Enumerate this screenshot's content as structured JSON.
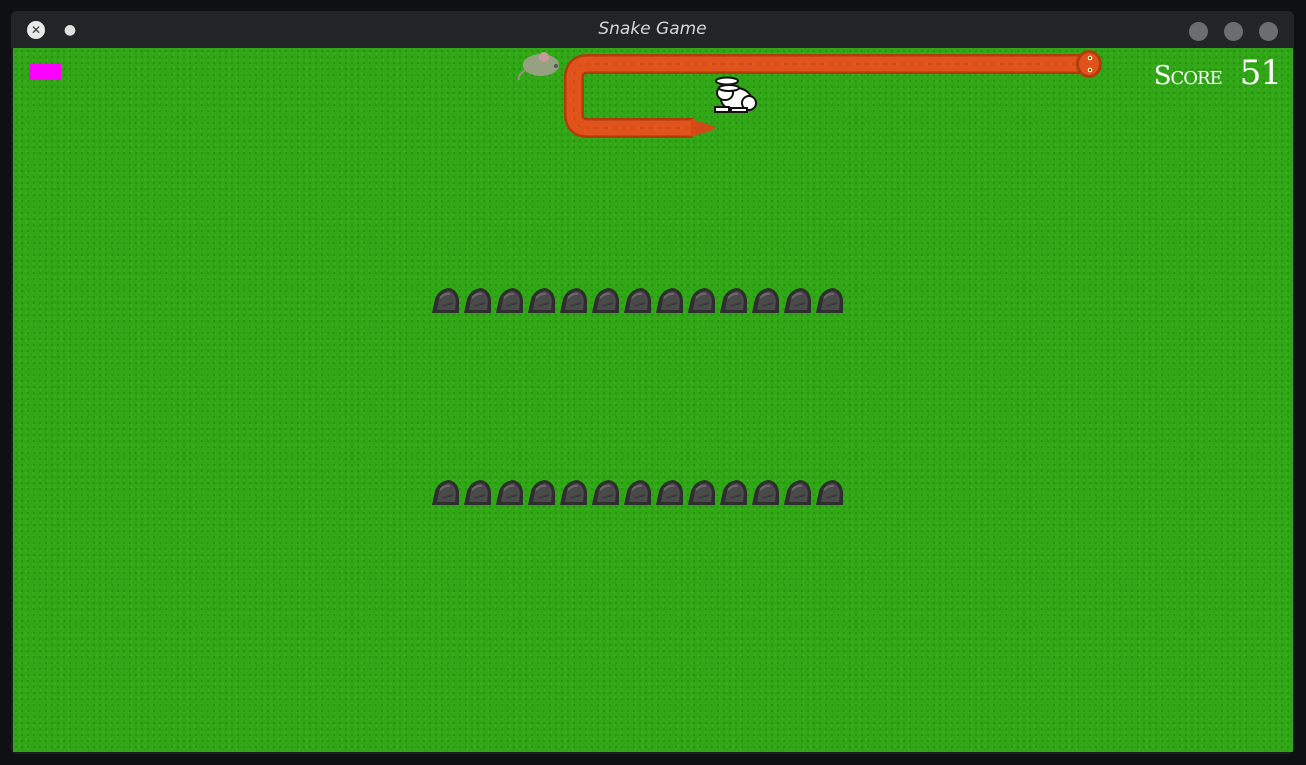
{
  "window": {
    "title": "Snake Game",
    "app_icon": "x-logo-icon",
    "menu_icon": "dot-icon",
    "controls": [
      "minimize-button",
      "maximize-button",
      "close-button"
    ]
  },
  "hud": {
    "score_label": "Score",
    "score_value": "51",
    "level_indicator_color": "#ff00ff"
  },
  "board": {
    "grass_color": "#31a717",
    "snake_color": "#e0531b",
    "rock_row_count": 2,
    "rocks_per_row": 13
  },
  "entities": {
    "snake": "snake",
    "rabbit": "rabbit-icon",
    "mouse": "mouse-icon",
    "rock": "rock-icon"
  }
}
